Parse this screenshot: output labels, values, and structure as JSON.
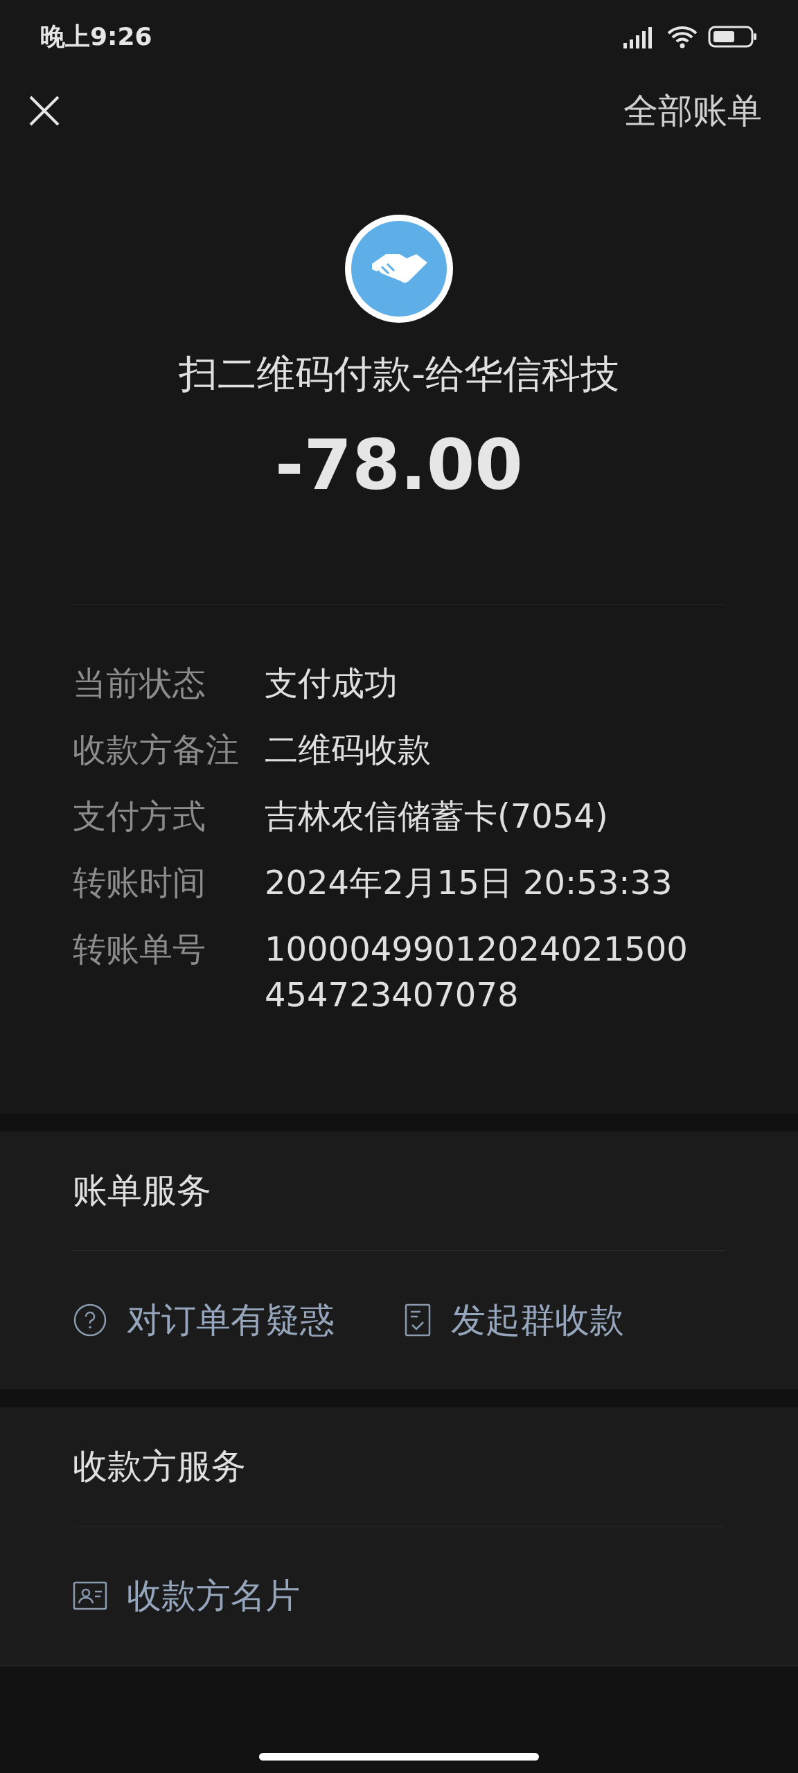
{
  "status_bar": {
    "time": "晚上9:26"
  },
  "header": {
    "all_bills": "全部账单"
  },
  "merchant": {
    "title": "扫二维码付款-给华信科技",
    "amount": "-78.00"
  },
  "details": [
    {
      "label": "当前状态",
      "value": "支付成功"
    },
    {
      "label": "收款方备注",
      "value": "二维码收款"
    },
    {
      "label": "支付方式",
      "value": "吉林农信储蓄卡(7054)"
    },
    {
      "label": "转账时间",
      "value": "2024年2月15日 20:53:33"
    },
    {
      "label": "转账单号",
      "value": "10000499012024021500454723407078"
    }
  ],
  "sections": [
    {
      "title": "账单服务",
      "items": [
        {
          "kind": "question",
          "label": "对订单有疑惑"
        },
        {
          "kind": "receipt",
          "label": "发起群收款"
        }
      ]
    },
    {
      "title": "收款方服务",
      "items": [
        {
          "kind": "card",
          "label": "收款方名片"
        }
      ]
    }
  ]
}
